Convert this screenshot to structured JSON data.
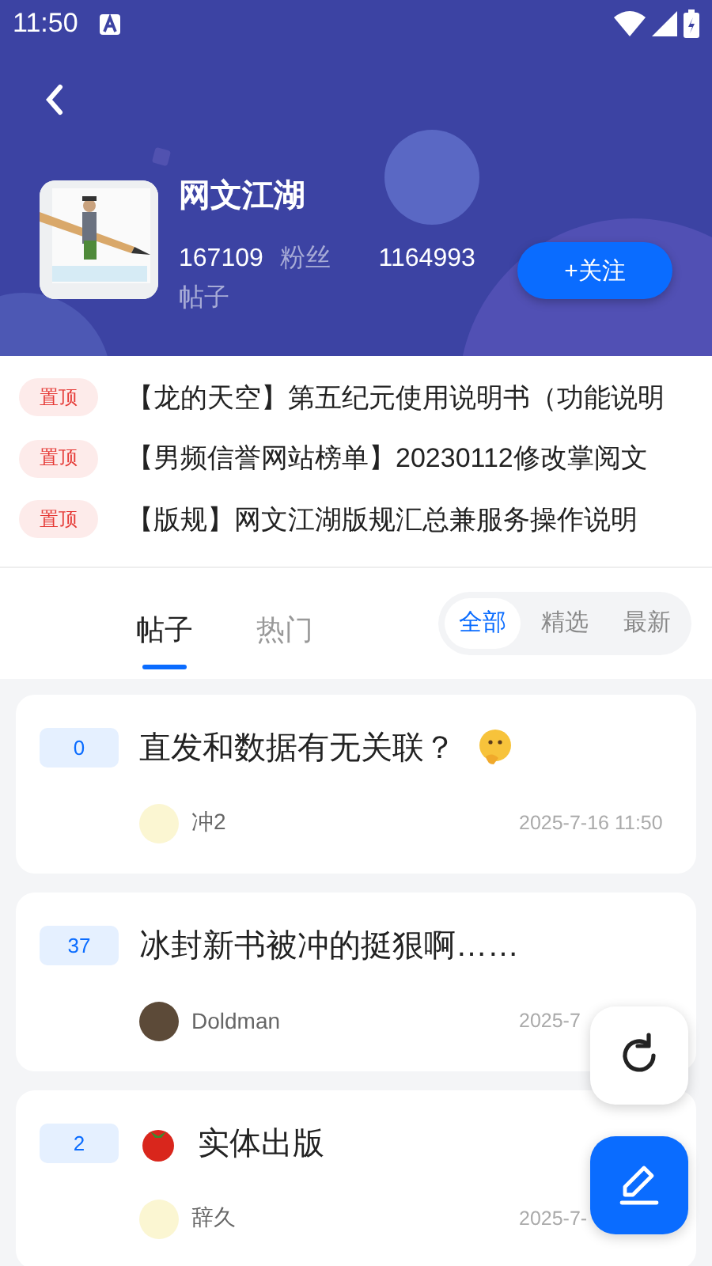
{
  "status_bar": {
    "time": "11:50"
  },
  "forum": {
    "name": "网文江湖",
    "stats": [
      {
        "text": "167109",
        "kind": "count"
      },
      {
        "text": "粉丝",
        "kind": "label"
      },
      {
        "text": "1164993",
        "kind": "count"
      },
      {
        "text": "帖子",
        "kind": "label"
      }
    ],
    "follow_button": "+关注"
  },
  "pinned": [
    {
      "tag": "置顶",
      "title": "【龙的天空】第五纪元使用说明书（功能说明"
    },
    {
      "tag": "置顶",
      "title": "【男频信誉网站榜单】20230112修改掌阅文"
    },
    {
      "tag": "置顶",
      "title": "【版规】网文江湖版规汇总兼服务操作说明"
    }
  ],
  "tabs": [
    {
      "label": "帖子",
      "selected": true
    },
    {
      "label": "热门",
      "selected": false
    }
  ],
  "filters": [
    {
      "label": "全部",
      "selected": true
    },
    {
      "label": "精选",
      "selected": false
    },
    {
      "label": "最新",
      "selected": false
    }
  ],
  "posts": [
    {
      "count": "0",
      "title": "直发和数据有无关联？",
      "kind": "question",
      "author": "冲2",
      "time": "2025-7-16 11:50"
    },
    {
      "count": "37",
      "title": "冰封新书被冲的挺狠啊……",
      "kind": "plain",
      "author": "Doldman",
      "time": "2025-7"
    },
    {
      "count": "2",
      "title": "实体出版",
      "kind": "publishing",
      "author": "辞久",
      "time": "2025-7-"
    }
  ]
}
